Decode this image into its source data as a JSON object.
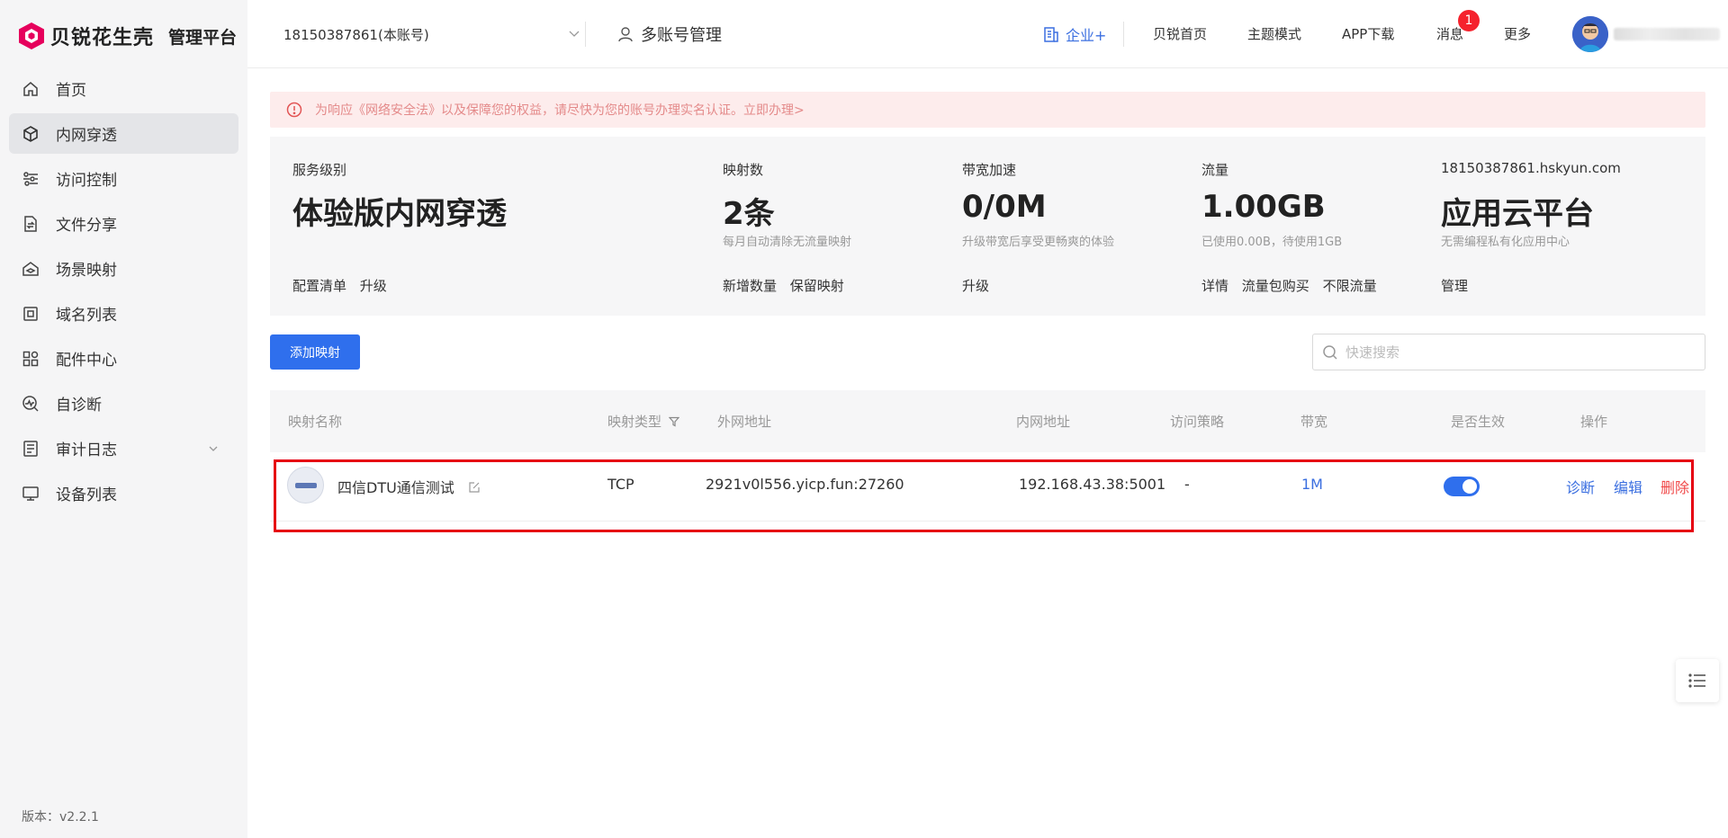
{
  "brand": {
    "name": "贝锐花生壳",
    "sub": "管理平台",
    "accent": "#e6005c"
  },
  "sidebar": {
    "items": [
      {
        "label": "首页",
        "icon": "home-icon",
        "active": false
      },
      {
        "label": "内网穿透",
        "icon": "cube-icon",
        "active": true
      },
      {
        "label": "访问控制",
        "icon": "sliders-icon",
        "active": false
      },
      {
        "label": "文件分享",
        "icon": "file-share-icon",
        "active": false
      },
      {
        "label": "场景映射",
        "icon": "house-layers-icon",
        "active": false
      },
      {
        "label": "域名列表",
        "icon": "domain-icon",
        "active": false
      },
      {
        "label": "配件中心",
        "icon": "grid-icon",
        "active": false
      },
      {
        "label": "自诊断",
        "icon": "diagnose-icon",
        "active": false
      },
      {
        "label": "审计日志",
        "icon": "log-icon",
        "active": false
      },
      {
        "label": "设备列表",
        "icon": "monitor-icon",
        "active": false
      }
    ],
    "version": "版本：v2.2.1"
  },
  "header": {
    "account": "18150387861(本账号)",
    "multi_account": "多账号管理",
    "enterprise": "企业+",
    "links": [
      "贝锐首页",
      "主题模式",
      "APP下载",
      "消息",
      "更多"
    ],
    "message_count": "1"
  },
  "alert": {
    "text": "为响应《网络安全法》以及保障您的权益，请尽快为您的账号办理实名认证。立即办理>"
  },
  "summary": {
    "service": {
      "label": "服务级别",
      "value": "体验版内网穿透",
      "desc": "",
      "actions": [
        "配置清单",
        "升级"
      ]
    },
    "mappings": {
      "label": "映射数",
      "value": "2条",
      "desc": "每月自动清除无流量映射",
      "actions": [
        "新增数量",
        "保留映射"
      ]
    },
    "bandwidth": {
      "label": "带宽加速",
      "value": "0/0M",
      "desc": "升级带宽后享受更畅爽的体验",
      "actions": [
        "升级"
      ]
    },
    "traffic": {
      "label": "流量",
      "value": "1.00GB",
      "desc": "已使用0.00B，待使用1GB",
      "actions": [
        "详情",
        "流量包购买",
        "不限流量"
      ]
    },
    "cloud": {
      "label": "18150387861.hskyun.com",
      "value": "应用云平台",
      "desc": "无需编程私有化应用中心",
      "actions": [
        "管理"
      ]
    }
  },
  "toolbar": {
    "add_label": "添加映射",
    "search_placeholder": "快速搜索"
  },
  "table": {
    "headers": {
      "name": "映射名称",
      "type": "映射类型",
      "external": "外网地址",
      "internal": "内网地址",
      "policy": "访问策略",
      "bandwidth": "带宽",
      "enabled": "是否生效",
      "actions": "操作"
    },
    "rows": [
      {
        "name": "四信DTU通信测试",
        "type": "TCP",
        "external": "2921v0l556.yicp.fun:27260",
        "internal": "192.168.43.38:5001",
        "policy": "-",
        "bandwidth": "1M",
        "enabled": true,
        "actions": [
          "诊断",
          "编辑",
          "删除"
        ]
      }
    ]
  }
}
